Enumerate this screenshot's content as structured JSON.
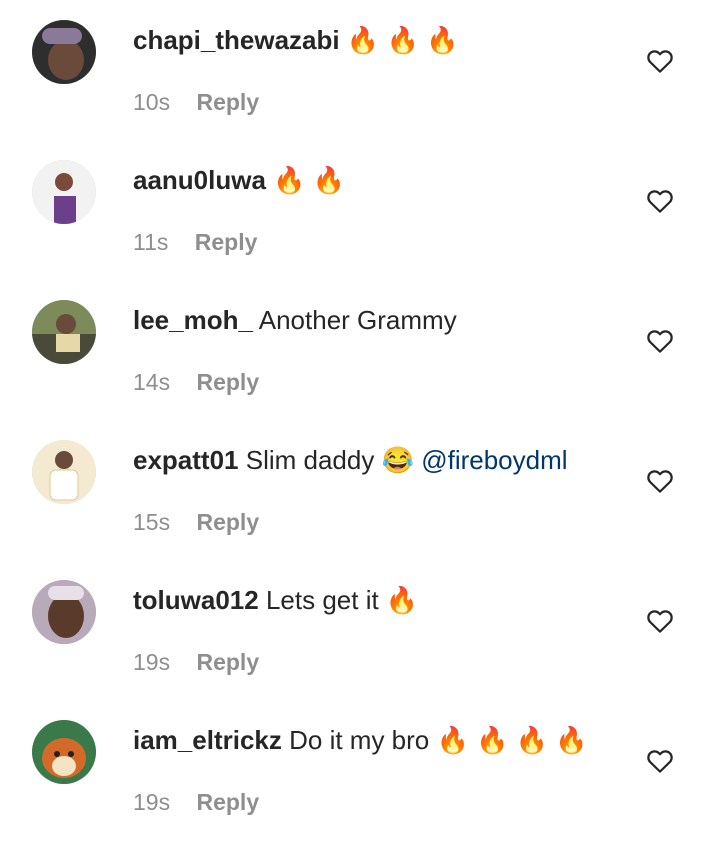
{
  "comments": [
    {
      "username": "chapi_thewazabi",
      "text": "",
      "emoji": "🔥 🔥 🔥",
      "mention": "",
      "time": "10s",
      "reply": "Reply",
      "avatar_color": "#3a3a3a"
    },
    {
      "username": "aanu0luwa",
      "text": "",
      "emoji": "🔥 🔥",
      "mention": "",
      "time": "11s",
      "reply": "Reply",
      "avatar_color": "#6b4a8a"
    },
    {
      "username": "lee_moh_",
      "text": "Another Grammy",
      "emoji": "",
      "mention": "",
      "time": "14s",
      "reply": "Reply",
      "avatar_color": "#5a6a4a"
    },
    {
      "username": "expatt01",
      "text": "Slim daddy",
      "emoji": "😂",
      "mention": "@fireboydml",
      "time": "15s",
      "reply": "Reply",
      "avatar_color": "#e8c89a"
    },
    {
      "username": "toluwa012",
      "text": "Lets get it",
      "emoji": "🔥",
      "mention": "",
      "time": "19s",
      "reply": "Reply",
      "avatar_color": "#8a7a8a"
    },
    {
      "username": "iam_eltrickz",
      "text": "Do it my bro",
      "emoji": "🔥 🔥 🔥 🔥",
      "mention": "",
      "time": "19s",
      "reply": "Reply",
      "avatar_color": "#d46a2a"
    }
  ],
  "colors": {
    "text": "#262626",
    "meta": "#8e8e8e",
    "mention": "#00376b"
  }
}
